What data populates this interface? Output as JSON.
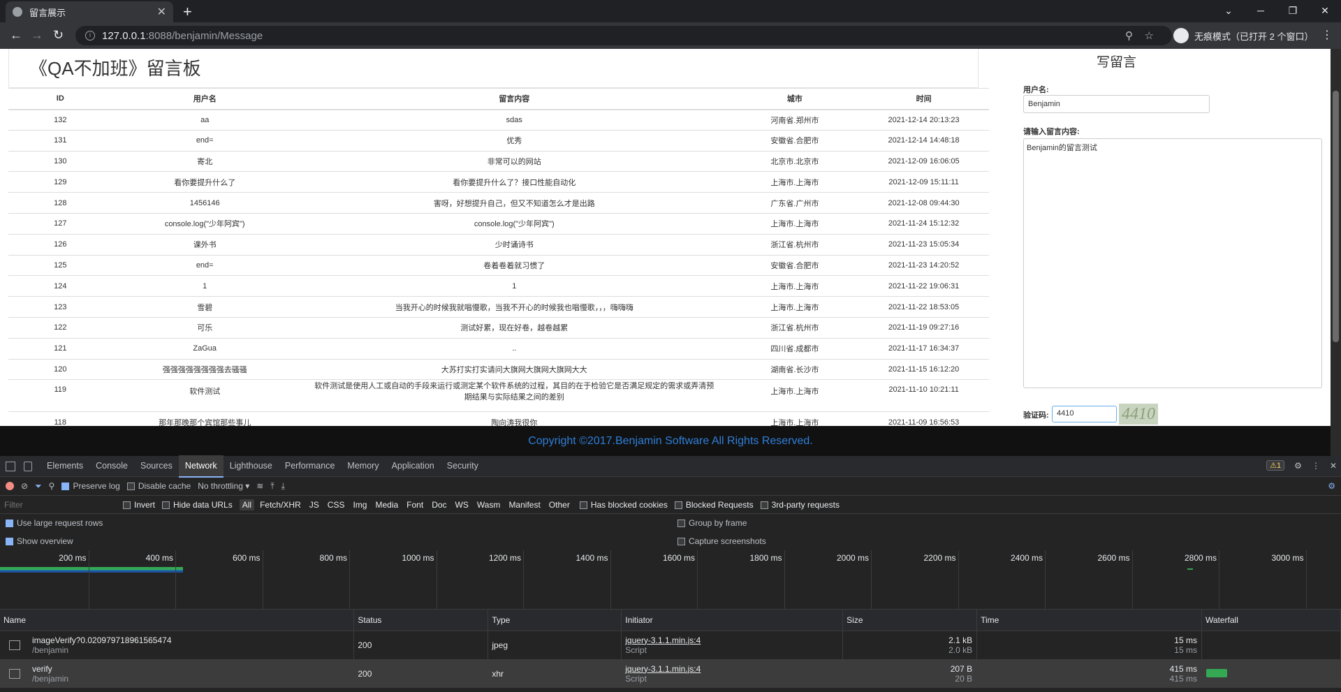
{
  "browser": {
    "tab_title": "留言展示",
    "url_host": "127.0.0.1",
    "url_rest": ":8088/benjamin/Message",
    "incognito_label": "无痕模式（已打开 2 个窗口）"
  },
  "page": {
    "title": "《QA不加班》留言板",
    "columns": [
      "ID",
      "用户名",
      "留言内容",
      "城市",
      "时间"
    ],
    "rows": [
      {
        "id": "132",
        "user": "aa",
        "content": "sdas",
        "city": "河南省.郑州市",
        "time": "2021-12-14 20:13:23"
      },
      {
        "id": "131",
        "user": "end=",
        "content": "优秀",
        "city": "安徽省.合肥市",
        "time": "2021-12-14 14:48:18"
      },
      {
        "id": "130",
        "user": "寄北",
        "content": "非常可以的网站",
        "city": "北京市.北京市",
        "time": "2021-12-09 16:06:05"
      },
      {
        "id": "129",
        "user": "看你要提升什么了",
        "content": "看你要提升什么了？接口性能自动化",
        "city": "上海市.上海市",
        "time": "2021-12-09 15:11:11"
      },
      {
        "id": "128",
        "user": "1456146",
        "content": "害呀，好想提升自己，但又不知道怎么才是出路",
        "city": "广东省.广州市",
        "time": "2021-12-08 09:44:30"
      },
      {
        "id": "127",
        "user": "console.log(\"少年阿宾\")",
        "content": "console.log(\"少年阿宾\")",
        "city": "上海市.上海市",
        "time": "2021-11-24 15:12:32"
      },
      {
        "id": "126",
        "user": "课外书",
        "content": "少时诵诗书",
        "city": "浙江省.杭州市",
        "time": "2021-11-23 15:05:34"
      },
      {
        "id": "125",
        "user": "end=",
        "content": "卷着卷着就习惯了",
        "city": "安徽省.合肥市",
        "time": "2021-11-23 14:20:52"
      },
      {
        "id": "124",
        "user": "1",
        "content": "1",
        "city": "上海市.上海市",
        "time": "2021-11-22 19:06:31"
      },
      {
        "id": "123",
        "user": "雪碧",
        "content": "当我开心的时候我就唱慢歌，当我不开心的时候我也唱慢歌，，，嗨嗨嗨",
        "city": "上海市.上海市",
        "time": "2021-11-22 18:53:05"
      },
      {
        "id": "122",
        "user": "可乐",
        "content": "测试好累，现在好卷，越卷越累",
        "city": "浙江省.杭州市",
        "time": "2021-11-19 09:27:16"
      },
      {
        "id": "121",
        "user": "ZaGua",
        "content": "..",
        "city": "四川省.成都市",
        "time": "2021-11-17 16:34:37"
      },
      {
        "id": "120",
        "user": "强强强强强强强强去骚骚",
        "content": "大苏打实打实请问大旗网大旗网大旗网大大",
        "city": "湖南省.长沙市",
        "time": "2021-11-15 16:12:20"
      },
      {
        "id": "119",
        "user": "软件测试",
        "content": "软件测试是使用人工或自动的手段来运行或测定某个软件系统的过程，其目的在于检验它是否满足规定的需求或弄清预期结果与实际结果之间的差别",
        "city": "上海市.上海市",
        "time": "2021-11-10 10:21:11",
        "tall": true
      },
      {
        "id": "118",
        "user": "那年那晚那个宾馆那些事儿",
        "content": "陶向涛我很你",
        "city": "上海市.上海市",
        "time": "2021-11-09 16:56:53"
      }
    ],
    "form": {
      "heading": "写留言",
      "username_label": "用户名:",
      "username_value": "Benjamin",
      "content_label": "请输入留言内容:",
      "content_value": "Benjamin的留言测试",
      "captcha_label": "验证码:",
      "captcha_value": "4410",
      "captcha_image_text": "4410"
    },
    "footer": "Copyright ©2017.Benjamin Software All Rights Reserved."
  },
  "devtools": {
    "tabs": [
      "Elements",
      "Console",
      "Sources",
      "Network",
      "Lighthouse",
      "Performance",
      "Memory",
      "Application",
      "Security"
    ],
    "active_tab": "Network",
    "warning_count": "1",
    "preserve_log": "Preserve log",
    "disable_cache": "Disable cache",
    "throttling": "No throttling",
    "filter_placeholder": "Filter",
    "invert": "Invert",
    "hide_data_urls": "Hide data URLs",
    "types": [
      "All",
      "Fetch/XHR",
      "JS",
      "CSS",
      "Img",
      "Media",
      "Font",
      "Doc",
      "WS",
      "Wasm",
      "Manifest",
      "Other"
    ],
    "has_blocked_cookies": "Has blocked cookies",
    "blocked_requests": "Blocked Requests",
    "third_party": "3rd-party requests",
    "large_rows": "Use large request rows",
    "group_by_frame": "Group by frame",
    "show_overview": "Show overview",
    "capture_screenshots": "Capture screenshots",
    "timeline_ticks": [
      "200 ms",
      "400 ms",
      "600 ms",
      "800 ms",
      "1000 ms",
      "1200 ms",
      "1400 ms",
      "1600 ms",
      "1800 ms",
      "2000 ms",
      "2200 ms",
      "2400 ms",
      "2600 ms",
      "2800 ms",
      "3000 ms"
    ],
    "columns": [
      "Name",
      "Status",
      "Type",
      "Initiator",
      "Size",
      "Time",
      "Waterfall"
    ],
    "requests": [
      {
        "name": "imageVerify?0.020979718961565474",
        "path": "/benjamin",
        "status": "200",
        "type": "jpeg",
        "initiator": "jquery-3.1.1.min.js:4",
        "initiator_type": "Script",
        "size": "2.1 kB",
        "size2": "2.0 kB",
        "time": "15 ms",
        "time2": "15 ms"
      },
      {
        "name": "verify",
        "path": "/benjamin",
        "status": "200",
        "type": "xhr",
        "initiator": "jquery-3.1.1.min.js:4",
        "initiator_type": "Script",
        "size": "207 B",
        "size2": "20 B",
        "time": "415 ms",
        "time2": "415 ms"
      }
    ]
  }
}
